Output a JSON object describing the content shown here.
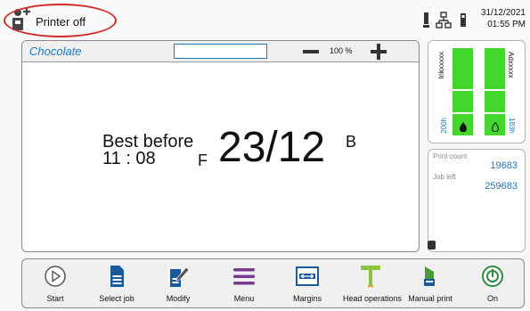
{
  "status": {
    "printer_state": "Printer off",
    "date": "31/12/2021",
    "time": "01:55 PM"
  },
  "message": {
    "name": "Chocolate",
    "field_value": "",
    "zoom": "100 %",
    "content": {
      "best_before": "Best before",
      "time": "11 : 08",
      "shift": "F",
      "date": "23/12",
      "suffix": "B"
    }
  },
  "consumables": {
    "ink": {
      "label": "Inkxxxxx",
      "level": "200h"
    },
    "additive": {
      "label": "Adxxxxx",
      "level": "183h"
    }
  },
  "counts": {
    "print_count_label": "Print count",
    "print_count_value": "19683",
    "job_left_label": "Job left",
    "job_left_value": "259683"
  },
  "toolbar": {
    "buttons": [
      {
        "label": "Start",
        "icon": "play-circle-icon"
      },
      {
        "label": "Select job",
        "icon": "document-icon"
      },
      {
        "label": "Modify",
        "icon": "edit-document-icon"
      },
      {
        "label": "Menu",
        "icon": "hamburger-menu-icon"
      },
      {
        "label": "Margins",
        "icon": "margins-icon"
      },
      {
        "label": "Head operations",
        "icon": "print-head-icon"
      },
      {
        "label": "Manual print",
        "icon": "manual-print-icon"
      },
      {
        "label": "On",
        "icon": "power-icon"
      }
    ]
  },
  "colors": {
    "accent_blue": "#1a78c2",
    "ink_green": "#44d62c",
    "menu_purple": "#7a3b8f",
    "head_green": "#8cc63f",
    "power_green": "#2e8b3d",
    "status_oval_red": "#d12a2a"
  }
}
